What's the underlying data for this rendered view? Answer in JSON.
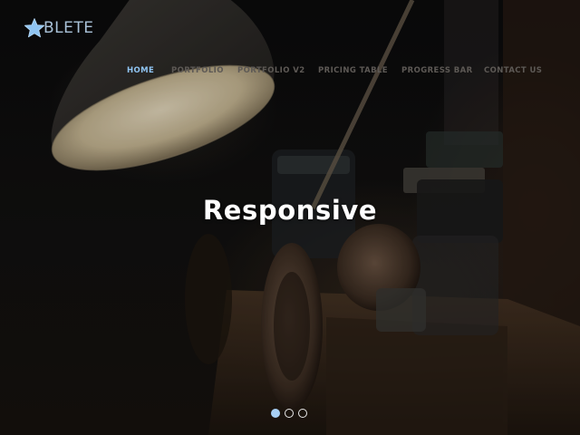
{
  "brand": {
    "logo_text": "BLETE",
    "logo_icon": "star-icon",
    "accent_color": "#8fc4f2"
  },
  "nav": {
    "items": [
      {
        "label": "HOME",
        "active": true
      },
      {
        "label": "PORTFOLIO",
        "active": false
      },
      {
        "label": "PORTFOLIO V2",
        "active": false
      },
      {
        "label": "PRICING TABLE",
        "active": false
      },
      {
        "label": "PROGRESS BAR",
        "active": false
      },
      {
        "label": "CONTACT US",
        "active": false
      }
    ]
  },
  "slider": {
    "title": "Responsive",
    "slide_count": 3,
    "active_index": 0
  }
}
